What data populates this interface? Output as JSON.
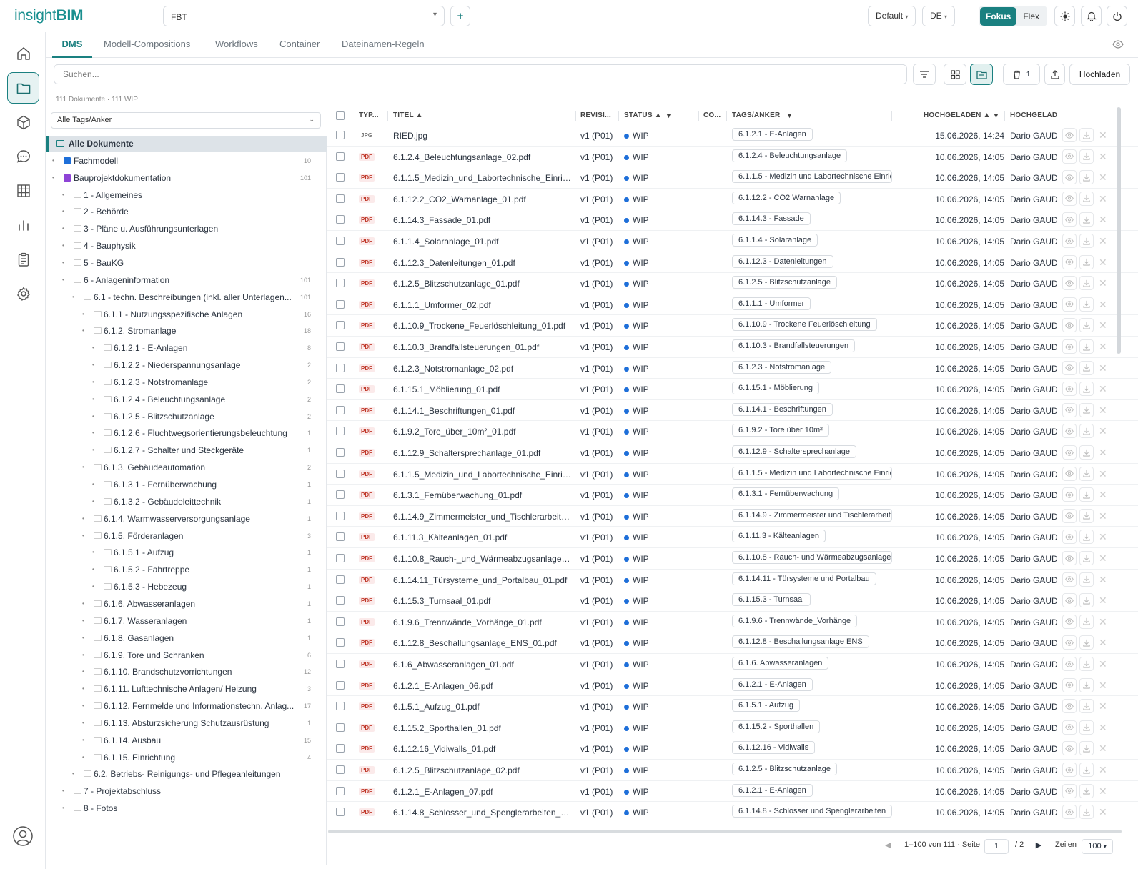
{
  "app": {
    "brand_prefix": "insight",
    "brand_suffix": "BIM"
  },
  "topbar": {
    "project": "FBT",
    "add_label": "+",
    "view_preset": "Default",
    "language": "DE",
    "mode_active": "Fokus",
    "mode_other": "Flex"
  },
  "tabs": [
    "DMS",
    "Modell-Compositions",
    "Workflows",
    "Container",
    "Dateinamen-Regeln"
  ],
  "toolbar": {
    "search_placeholder": "Suchen...",
    "trash_count": "1",
    "upload_label": "Hochladen"
  },
  "summary": "111 Dokumente · 111 WIP",
  "tag_filter": "Alle Tags/Anker",
  "tree": [
    {
      "label": "Alle Dokumente",
      "count": "",
      "level": 0,
      "kind": "all"
    },
    {
      "label": "Fachmodell",
      "count": "10",
      "level": 0,
      "kind": "blue"
    },
    {
      "label": "Bauprojektdokumentation",
      "count": "101",
      "level": 0,
      "kind": "purple"
    },
    {
      "label": "1 - Allgemeines",
      "count": "",
      "level": 1
    },
    {
      "label": "2 - Behörde",
      "count": "",
      "level": 1
    },
    {
      "label": "3 - Pläne u. Ausführungsunterlagen",
      "count": "",
      "level": 1
    },
    {
      "label": "4 - Bauphysik",
      "count": "",
      "level": 1
    },
    {
      "label": "5 - BauKG",
      "count": "",
      "level": 1
    },
    {
      "label": "6 - Anlageninformation",
      "count": "101",
      "level": 1
    },
    {
      "label": "6.1 - techn. Beschreibungen (inkl. aller Unterlagen...",
      "count": "101",
      "level": 2
    },
    {
      "label": "6.1.1 - Nutzungsspezifische Anlagen",
      "count": "16",
      "level": 3
    },
    {
      "label": "6.1.2. Stromanlage",
      "count": "18",
      "level": 3
    },
    {
      "label": "6.1.2.1 - E-Anlagen",
      "count": "8",
      "level": 4
    },
    {
      "label": "6.1.2.2 - Niederspannungsanlage",
      "count": "2",
      "level": 4
    },
    {
      "label": "6.1.2.3 - Notstromanlage",
      "count": "2",
      "level": 4
    },
    {
      "label": "6.1.2.4 - Beleuchtungsanlage",
      "count": "2",
      "level": 4
    },
    {
      "label": "6.1.2.5 - Blitzschutzanlage",
      "count": "2",
      "level": 4
    },
    {
      "label": "6.1.2.6 - Fluchtwegsorientierungsbeleuchtung",
      "count": "1",
      "level": 4
    },
    {
      "label": "6.1.2.7 - Schalter und Steckgeräte",
      "count": "1",
      "level": 4
    },
    {
      "label": "6.1.3. Gebäudeautomation",
      "count": "2",
      "level": 3
    },
    {
      "label": "6.1.3.1 - Fernüberwachung",
      "count": "1",
      "level": 4
    },
    {
      "label": "6.1.3.2 - Gebäudeleittechnik",
      "count": "1",
      "level": 4
    },
    {
      "label": "6.1.4. Warmwasserversorgungsanlage",
      "count": "1",
      "level": 3
    },
    {
      "label": "6.1.5. Förderanlagen",
      "count": "3",
      "level": 3
    },
    {
      "label": "6.1.5.1 - Aufzug",
      "count": "1",
      "level": 4
    },
    {
      "label": "6.1.5.2 - Fahrtreppe",
      "count": "1",
      "level": 4
    },
    {
      "label": "6.1.5.3 - Hebezeug",
      "count": "1",
      "level": 4
    },
    {
      "label": "6.1.6. Abwasseranlagen",
      "count": "1",
      "level": 3
    },
    {
      "label": "6.1.7. Wasseranlagen",
      "count": "1",
      "level": 3
    },
    {
      "label": "6.1.8. Gasanlagen",
      "count": "1",
      "level": 3
    },
    {
      "label": "6.1.9. Tore und Schranken",
      "count": "6",
      "level": 3
    },
    {
      "label": "6.1.10. Brandschutzvorrichtungen",
      "count": "12",
      "level": 3
    },
    {
      "label": "6.1.11. Lufttechnische Anlagen/ Heizung",
      "count": "3",
      "level": 3
    },
    {
      "label": "6.1.12. Fernmelde und Informationstechn. Anlag...",
      "count": "17",
      "level": 3
    },
    {
      "label": "6.1.13. Absturzsicherung Schutzausrüstung",
      "count": "1",
      "level": 3
    },
    {
      "label": "6.1.14. Ausbau",
      "count": "15",
      "level": 3
    },
    {
      "label": "6.1.15. Einrichtung",
      "count": "4",
      "level": 3
    },
    {
      "label": "6.2. Betriebs- Reinigungs- und Pflegeanleitungen",
      "count": "",
      "level": 2
    },
    {
      "label": "7 - Projektabschluss",
      "count": "",
      "level": 1
    },
    {
      "label": "8 - Fotos",
      "count": "",
      "level": 1
    }
  ],
  "grid": {
    "headers": {
      "type": "TYP...",
      "title": "TITEL ▲",
      "revision": "REVISI...",
      "status": "STATUS ▲",
      "co": "CO...",
      "tags": "TAGS/ANKER",
      "uploaded": "HOCHGELADEN ▲",
      "uploader": "HOCHGELAD"
    },
    "rows": [
      {
        "type": "JPG",
        "title": "RIED.jpg",
        "rev": "v1 (P01)",
        "status": "WIP",
        "tag": "6.1.2.1 - E-Anlagen",
        "date": "15.06.2026, 14:24",
        "user": "Dario GAUDI"
      },
      {
        "type": "PDF",
        "title": "6.1.2.4_Beleuchtungsanlage_02.pdf",
        "rev": "v1 (P01)",
        "status": "WIP",
        "tag": "6.1.2.4 - Beleuchtungsanlage",
        "date": "10.06.2026, 14:05",
        "user": "Dario GAUDI"
      },
      {
        "type": "PDF",
        "title": "6.1.1.5_Medizin_und_Labortechnische_Einric...",
        "rev": "v1 (P01)",
        "status": "WIP",
        "tag": "6.1.1.5 - Medizin und Labortechnische Einric",
        "date": "10.06.2026, 14:05",
        "user": "Dario GAUDI"
      },
      {
        "type": "PDF",
        "title": "6.1.12.2_CO2_Warnanlage_01.pdf",
        "rev": "v1 (P01)",
        "status": "WIP",
        "tag": "6.1.12.2 - CO2 Warnanlage",
        "date": "10.06.2026, 14:05",
        "user": "Dario GAUDI"
      },
      {
        "type": "PDF",
        "title": "6.1.14.3_Fassade_01.pdf",
        "rev": "v1 (P01)",
        "status": "WIP",
        "tag": "6.1.14.3 - Fassade",
        "date": "10.06.2026, 14:05",
        "user": "Dario GAUDI"
      },
      {
        "type": "PDF",
        "title": "6.1.1.4_Solaranlage_01.pdf",
        "rev": "v1 (P01)",
        "status": "WIP",
        "tag": "6.1.1.4 - Solaranlage",
        "date": "10.06.2026, 14:05",
        "user": "Dario GAUDI"
      },
      {
        "type": "PDF",
        "title": "6.1.12.3_Datenleitungen_01.pdf",
        "rev": "v1 (P01)",
        "status": "WIP",
        "tag": "6.1.12.3 - Datenleitungen",
        "date": "10.06.2026, 14:05",
        "user": "Dario GAUDI"
      },
      {
        "type": "PDF",
        "title": "6.1.2.5_Blitzschutzanlage_01.pdf",
        "rev": "v1 (P01)",
        "status": "WIP",
        "tag": "6.1.2.5 - Blitzschutzanlage",
        "date": "10.06.2026, 14:05",
        "user": "Dario GAUDI"
      },
      {
        "type": "PDF",
        "title": "6.1.1.1_Umformer_02.pdf",
        "rev": "v1 (P01)",
        "status": "WIP",
        "tag": "6.1.1.1 - Umformer",
        "date": "10.06.2026, 14:05",
        "user": "Dario GAUDI"
      },
      {
        "type": "PDF",
        "title": "6.1.10.9_Trockene_Feuerlöschleitung_01.pdf",
        "rev": "v1 (P01)",
        "status": "WIP",
        "tag": "6.1.10.9 - Trockene Feuerlöschleitung",
        "date": "10.06.2026, 14:05",
        "user": "Dario GAUDI"
      },
      {
        "type": "PDF",
        "title": "6.1.10.3_Brandfallsteuerungen_01.pdf",
        "rev": "v1 (P01)",
        "status": "WIP",
        "tag": "6.1.10.3 - Brandfallsteuerungen",
        "date": "10.06.2026, 14:05",
        "user": "Dario GAUDI"
      },
      {
        "type": "PDF",
        "title": "6.1.2.3_Notstromanlage_02.pdf",
        "rev": "v1 (P01)",
        "status": "WIP",
        "tag": "6.1.2.3 - Notstromanlage",
        "date": "10.06.2026, 14:05",
        "user": "Dario GAUDI"
      },
      {
        "type": "PDF",
        "title": "6.1.15.1_Möblierung_01.pdf",
        "rev": "v1 (P01)",
        "status": "WIP",
        "tag": "6.1.15.1 - Möblierung",
        "date": "10.06.2026, 14:05",
        "user": "Dario GAUDI"
      },
      {
        "type": "PDF",
        "title": "6.1.14.1_Beschriftungen_01.pdf",
        "rev": "v1 (P01)",
        "status": "WIP",
        "tag": "6.1.14.1 - Beschriftungen",
        "date": "10.06.2026, 14:05",
        "user": "Dario GAUDI"
      },
      {
        "type": "PDF",
        "title": "6.1.9.2_Tore_über_10m²_01.pdf",
        "rev": "v1 (P01)",
        "status": "WIP",
        "tag": "6.1.9.2 - Tore über 10m²",
        "date": "10.06.2026, 14:05",
        "user": "Dario GAUDI"
      },
      {
        "type": "PDF",
        "title": "6.1.12.9_Schaltersprechanlage_01.pdf",
        "rev": "v1 (P01)",
        "status": "WIP",
        "tag": "6.1.12.9 - Schaltersprechanlage",
        "date": "10.06.2026, 14:05",
        "user": "Dario GAUDI"
      },
      {
        "type": "PDF",
        "title": "6.1.1.5_Medizin_und_Labortechnische_Einric...",
        "rev": "v1 (P01)",
        "status": "WIP",
        "tag": "6.1.1.5 - Medizin und Labortechnische Einric",
        "date": "10.06.2026, 14:05",
        "user": "Dario GAUDI"
      },
      {
        "type": "PDF",
        "title": "6.1.3.1_Fernüberwachung_01.pdf",
        "rev": "v1 (P01)",
        "status": "WIP",
        "tag": "6.1.3.1 - Fernüberwachung",
        "date": "10.06.2026, 14:05",
        "user": "Dario GAUDI"
      },
      {
        "type": "PDF",
        "title": "6.1.14.9_Zimmermeister_und_Tischlerarbeite...",
        "rev": "v1 (P01)",
        "status": "WIP",
        "tag": "6.1.14.9 - Zimmermeister und Tischlerarbeit",
        "date": "10.06.2026, 14:05",
        "user": "Dario GAUDI"
      },
      {
        "type": "PDF",
        "title": "6.1.11.3_Kälteanlagen_01.pdf",
        "rev": "v1 (P01)",
        "status": "WIP",
        "tag": "6.1.11.3 - Kälteanlagen",
        "date": "10.06.2026, 14:05",
        "user": "Dario GAUDI"
      },
      {
        "type": "PDF",
        "title": "6.1.10.8_Rauch-_und_Wärmeabzugsanlage_...",
        "rev": "v1 (P01)",
        "status": "WIP",
        "tag": "6.1.10.8 - Rauch- und Wärmeabzugsanlage",
        "date": "10.06.2026, 14:05",
        "user": "Dario GAUDI"
      },
      {
        "type": "PDF",
        "title": "6.1.14.11_Türsysteme_und_Portalbau_01.pdf",
        "rev": "v1 (P01)",
        "status": "WIP",
        "tag": "6.1.14.11 - Türsysteme und Portalbau",
        "date": "10.06.2026, 14:05",
        "user": "Dario GAUDI"
      },
      {
        "type": "PDF",
        "title": "6.1.15.3_Turnsaal_01.pdf",
        "rev": "v1 (P01)",
        "status": "WIP",
        "tag": "6.1.15.3 - Turnsaal",
        "date": "10.06.2026, 14:05",
        "user": "Dario GAUDI"
      },
      {
        "type": "PDF",
        "title": "6.1.9.6_Trennwände_Vorhänge_01.pdf",
        "rev": "v1 (P01)",
        "status": "WIP",
        "tag": "6.1.9.6 - Trennwände_Vorhänge",
        "date": "10.06.2026, 14:05",
        "user": "Dario GAUDI"
      },
      {
        "type": "PDF",
        "title": "6.1.12.8_Beschallungsanlage_ENS_01.pdf",
        "rev": "v1 (P01)",
        "status": "WIP",
        "tag": "6.1.12.8 - Beschallungsanlage ENS",
        "date": "10.06.2026, 14:05",
        "user": "Dario GAUDI"
      },
      {
        "type": "PDF",
        "title": "6.1.6_Abwasseranlagen_01.pdf",
        "rev": "v1 (P01)",
        "status": "WIP",
        "tag": "6.1.6. Abwasseranlagen",
        "date": "10.06.2026, 14:05",
        "user": "Dario GAUDI"
      },
      {
        "type": "PDF",
        "title": "6.1.2.1_E-Anlagen_06.pdf",
        "rev": "v1 (P01)",
        "status": "WIP",
        "tag": "6.1.2.1 - E-Anlagen",
        "date": "10.06.2026, 14:05",
        "user": "Dario GAUDI"
      },
      {
        "type": "PDF",
        "title": "6.1.5.1_Aufzug_01.pdf",
        "rev": "v1 (P01)",
        "status": "WIP",
        "tag": "6.1.5.1 - Aufzug",
        "date": "10.06.2026, 14:05",
        "user": "Dario GAUDI"
      },
      {
        "type": "PDF",
        "title": "6.1.15.2_Sporthallen_01.pdf",
        "rev": "v1 (P01)",
        "status": "WIP",
        "tag": "6.1.15.2 - Sporthallen",
        "date": "10.06.2026, 14:05",
        "user": "Dario GAUDI"
      },
      {
        "type": "PDF",
        "title": "6.1.12.16_Vidiwalls_01.pdf",
        "rev": "v1 (P01)",
        "status": "WIP",
        "tag": "6.1.12.16 - Vidiwalls",
        "date": "10.06.2026, 14:05",
        "user": "Dario GAUDI"
      },
      {
        "type": "PDF",
        "title": "6.1.2.5_Blitzschutzanlage_02.pdf",
        "rev": "v1 (P01)",
        "status": "WIP",
        "tag": "6.1.2.5 - Blitzschutzanlage",
        "date": "10.06.2026, 14:05",
        "user": "Dario GAUDI"
      },
      {
        "type": "PDF",
        "title": "6.1.2.1_E-Anlagen_07.pdf",
        "rev": "v1 (P01)",
        "status": "WIP",
        "tag": "6.1.2.1 - E-Anlagen",
        "date": "10.06.2026, 14:05",
        "user": "Dario GAUDI"
      },
      {
        "type": "PDF",
        "title": "6.1.14.8_Schlosser_und_Spenglerarbeiten_01...",
        "rev": "v1 (P01)",
        "status": "WIP",
        "tag": "6.1.14.8 - Schlosser und Spenglerarbeiten",
        "date": "10.06.2026, 14:05",
        "user": "Dario GAUDI"
      }
    ]
  },
  "pager": {
    "range": "1–100 von 111 · Seite",
    "page": "1",
    "total": "/ 2",
    "rows_label": "Zeilen",
    "rows_value": "100"
  },
  "colors": {
    "accent": "#1a8080",
    "status_dot": "#1e6fd9",
    "pdf_badge": "#c0392b",
    "fachmodell": "#1e6fd9",
    "bauprojekt": "#8e44d6"
  }
}
